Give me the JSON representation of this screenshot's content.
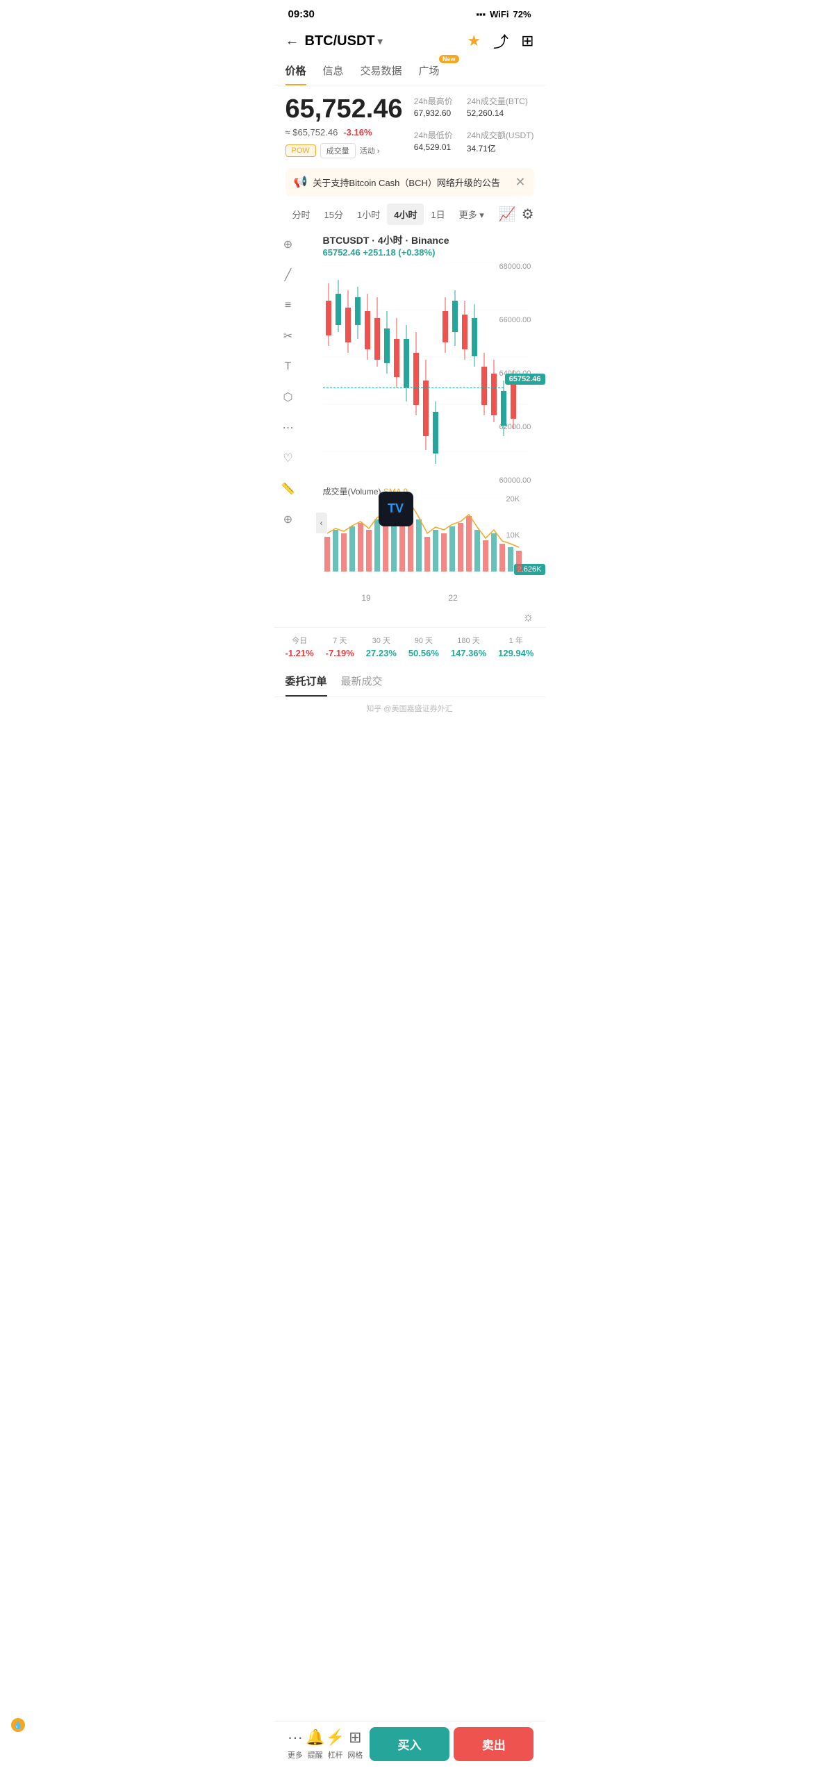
{
  "statusBar": {
    "time": "09:30",
    "locationIcon": "▶",
    "batteryLevel": "72"
  },
  "header": {
    "backLabel": "←",
    "title": "BTC/USDT",
    "chevron": "▾",
    "starIcon": "★",
    "shareIcon": "⤴",
    "gridIcon": "⊞"
  },
  "tabs": [
    {
      "id": "price",
      "label": "价格",
      "active": true
    },
    {
      "id": "info",
      "label": "信息",
      "active": false
    },
    {
      "id": "trading",
      "label": "交易数据",
      "active": false
    },
    {
      "id": "plaza",
      "label": "广场",
      "active": false,
      "badge": "New"
    }
  ],
  "price": {
    "main": "65,752.46",
    "usdEquiv": "≈ $65,752.46",
    "change": "-3.16%",
    "tags": [
      "POW",
      "成交量",
      "活动 ›"
    ],
    "stats": {
      "high24h": {
        "label": "24h最高价",
        "value": "67,932.60"
      },
      "volume24h": {
        "label": "24h成交量(BTC)",
        "value": "52,260.14"
      },
      "low24h": {
        "label": "24h最低价",
        "value": "64,529.01"
      },
      "turnover24h": {
        "label": "24h成交额(USDT)",
        "value": "34.71亿"
      }
    }
  },
  "announcement": {
    "icon": "📢",
    "text": "关于支持Bitcoin Cash（BCH）网络升级的公告",
    "closeIcon": "✕"
  },
  "chart": {
    "timeframes": [
      "分时",
      "15分",
      "1小时",
      "4小时",
      "1日",
      "更多 ▾"
    ],
    "activeTimeframe": "4小时",
    "title": "BTCUSDT · 4小时 · Binance",
    "priceLabel": "65752.46  +251.18 (+0.38%)",
    "currentPrice": "65752.46",
    "priceLines": [
      "68000.00",
      "66000.00",
      "64000.00",
      "62000.00",
      "60000.00"
    ],
    "dateLabels": [
      "19",
      "22"
    ],
    "volumeLabel": "成交量(Volume)",
    "volumeSMA": "SMA 9",
    "volumeLevels": [
      "20K",
      "10K"
    ],
    "volumeCurrent": "2.626K"
  },
  "performance": [
    {
      "period": "今日",
      "value": "-1.21%",
      "color": "red"
    },
    {
      "period": "7 天",
      "value": "-7.19%",
      "color": "red"
    },
    {
      "period": "30 天",
      "value": "27.23%",
      "color": "green"
    },
    {
      "period": "90 天",
      "value": "50.56%",
      "color": "green"
    },
    {
      "period": "180 天",
      "value": "147.36%",
      "color": "green"
    },
    {
      "period": "1 年",
      "value": "129.94%",
      "color": "green"
    }
  ],
  "orderTabs": [
    {
      "label": "委托订单",
      "active": true
    },
    {
      "label": "最新成交",
      "active": false
    }
  ],
  "bottomBar": {
    "navItems": [
      {
        "icon": "···",
        "label": "更多"
      },
      {
        "icon": "🔔",
        "label": "提醒"
      },
      {
        "icon": "⚡",
        "label": "杠杆"
      },
      {
        "icon": "⊞",
        "label": "网格"
      }
    ],
    "buyLabel": "买入",
    "sellLabel": "卖出"
  },
  "watermark": "知乎 @美国嘉盛证券外汇"
}
